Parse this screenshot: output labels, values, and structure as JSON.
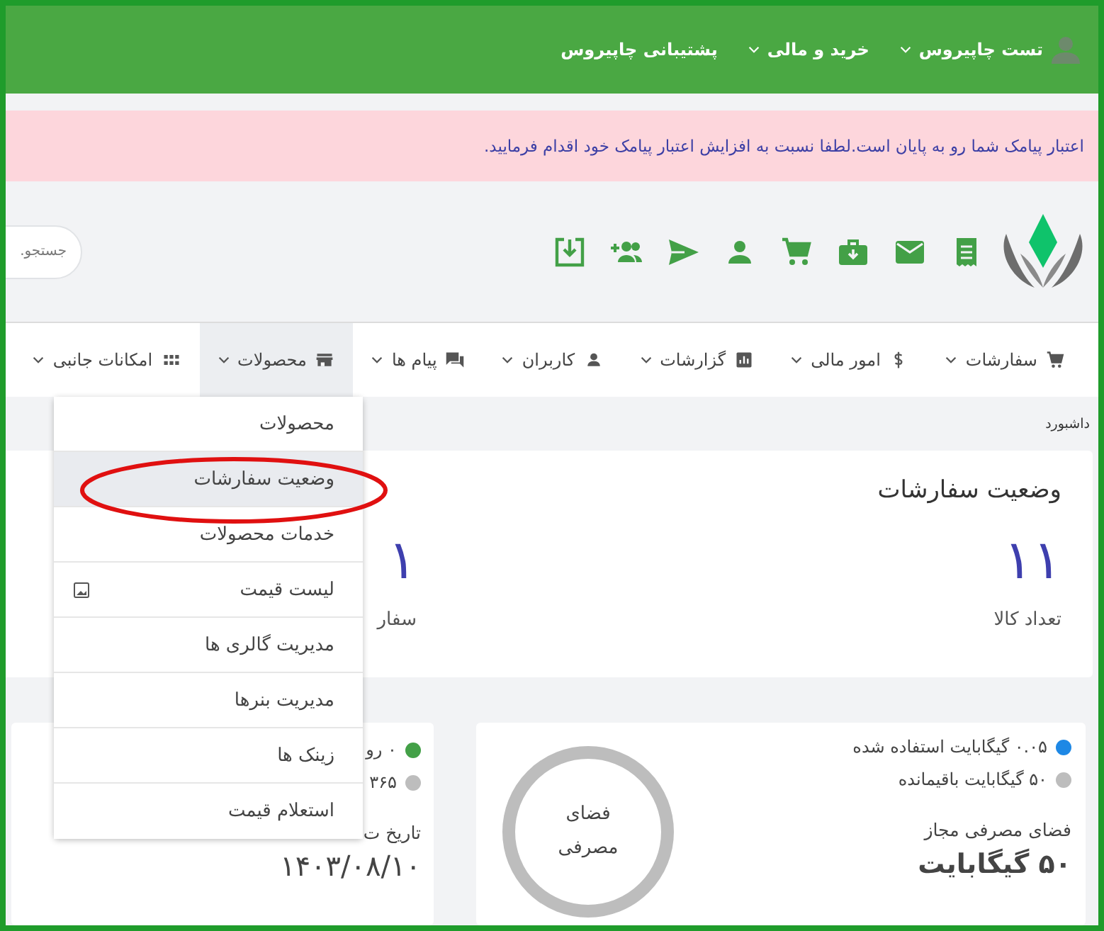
{
  "top_bar": {
    "items": [
      {
        "label": "تست چاپیروس",
        "dropdown": true,
        "avatar": true
      },
      {
        "label": "خرید و مالی",
        "dropdown": true,
        "avatar": false
      },
      {
        "label": "پشتیبانی چاپیروس",
        "dropdown": false,
        "avatar": false
      }
    ]
  },
  "alert": {
    "text": "اعتبار پیامک شما رو به پایان است.لطفا نسبت به افزایش اعتبار پیامک خود اقدام فرمایید."
  },
  "search": {
    "placeholder": "جستجو."
  },
  "nav": [
    {
      "label": "سفارشات",
      "selected": false
    },
    {
      "label": "امور مالی",
      "selected": false
    },
    {
      "label": "گزارشات",
      "selected": false
    },
    {
      "label": "کاربران",
      "selected": false
    },
    {
      "label": "پیام ها",
      "selected": false
    },
    {
      "label": "محصولات",
      "selected": true
    },
    {
      "label": "امکانات جانبی",
      "selected": false
    }
  ],
  "breadcrumb": "داشبورد",
  "orders_card": {
    "title": "وضعیت سفارشات",
    "stats": [
      {
        "value": "۱۱",
        "label": "تعداد کالا"
      },
      {
        "value": "۱",
        "label": "سفار"
      }
    ]
  },
  "storage_card": {
    "legend": [
      {
        "text": "۰.۰۵ گیگابایت استفاده شده",
        "color": "#1e88e5"
      },
      {
        "text": "۵۰ گیگابایت باقیمانده",
        "color": "#bdbdbd"
      }
    ],
    "allowed_label": "فضای مصرفی مجاز",
    "allowed_value": "۵۰ گیگابایت",
    "donut_label": "فضای مصرفی"
  },
  "plan_card": {
    "legend": [
      {
        "text": "۰ رو",
        "color": "#43a047"
      },
      {
        "text": "۳۶۵",
        "color": "#bdbdbd"
      }
    ],
    "date_label": "تاریخ ت",
    "date_value": "۱۴۰۳/۰۸/۱۰"
  },
  "dropdown_menu": [
    {
      "label": "محصولات",
      "selected": false,
      "kind": "plain"
    },
    {
      "label": "وضعیت سفارشات",
      "selected": true,
      "kind": "plain"
    },
    {
      "label": "خدمات محصولات",
      "selected": false,
      "kind": "plain"
    },
    {
      "label": "لیست قیمت",
      "selected": false,
      "kind": "with-icon"
    },
    {
      "label": "مدیریت گالری ها",
      "selected": false,
      "kind": "plain"
    },
    {
      "label": "مدیریت بنرها",
      "selected": false,
      "kind": "plain"
    },
    {
      "label": "زینک ها",
      "selected": false,
      "kind": "plain"
    },
    {
      "label": "استعلام قیمت",
      "selected": false,
      "kind": "plain"
    }
  ]
}
